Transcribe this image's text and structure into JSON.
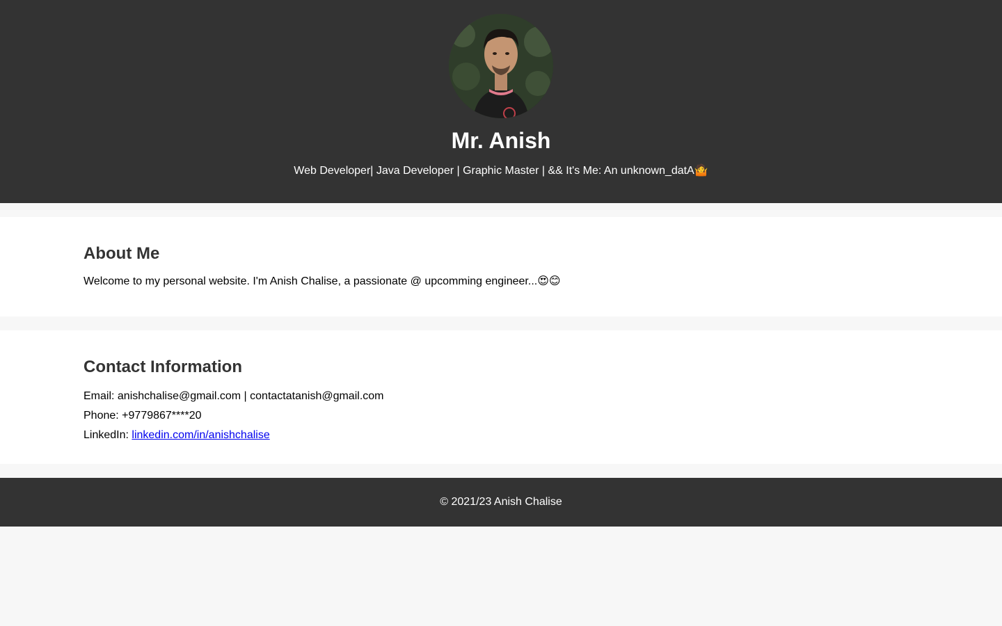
{
  "header": {
    "avatar_alt": "profile photo",
    "name": "Mr. Anish",
    "tagline": "Web Developer| Java Developer | Graphic Master | && It's Me: An unknown_datA🤷"
  },
  "about": {
    "title": "About Me",
    "text": "Welcome to my personal website. I'm Anish Chalise, a passionate @ upcomming engineer...😍😊"
  },
  "contact": {
    "title": "Contact Information",
    "email_label": "Email:",
    "email_value": "anishchalise@gmail.com | contactatanish@gmail.com",
    "phone_label": "Phone:",
    "phone_value": "+9779867****20",
    "linkedin_label": "LinkedIn:",
    "linkedin_link": "linkedin.com/in/anishchalise"
  },
  "footer": {
    "text": "© 2021/23 Anish Chalise"
  },
  "colors": {
    "header_bg": "#333333",
    "page_bg": "#f7f7f7",
    "section_bg": "#ffffff",
    "link": "#0000ee"
  }
}
